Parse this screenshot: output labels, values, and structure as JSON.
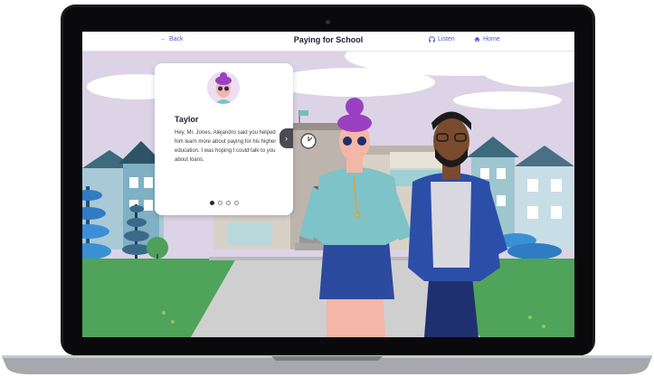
{
  "header": {
    "back_label": "Back",
    "title": "Paying for School",
    "listen_label": "Listen",
    "home_label": "Home"
  },
  "dialog": {
    "speaker": "Taylor",
    "message": "Hey, Mr. Jones, Alejandro said you helped him learn more about paying for his higher education. I was hoping I could talk to you about loans.",
    "page_count": 4,
    "current_page": 1
  },
  "colors": {
    "accent": "#4a5ad6",
    "sky": "#dcd3e6",
    "grass": "#4fa35a",
    "path": "#cfcfcf"
  },
  "icons": {
    "back": "arrow-left-icon",
    "listen": "headphones-icon",
    "home": "home-icon",
    "next": "chevron-right-icon"
  }
}
